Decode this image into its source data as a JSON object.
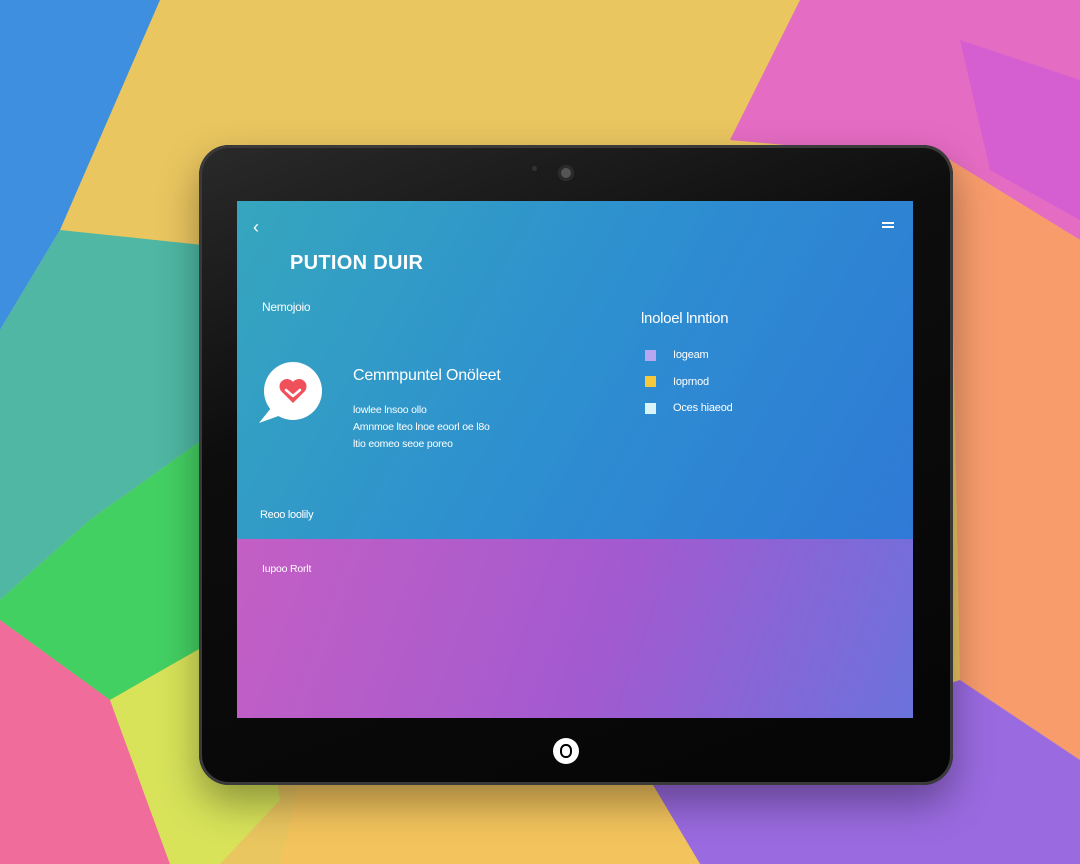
{
  "screen": {
    "title": "PUTION DUIR",
    "section_label": "Nemojoio",
    "card": {
      "title": "Cemmpuntel Onöleet",
      "description_lines": [
        "lowlee lnsoo ollo",
        "Amnmoe lteo lnoe eoorl oe l8o",
        "ltio eomeo seoe poreo"
      ]
    },
    "legend": {
      "title": "lnoloel lnntion",
      "items": [
        {
          "label": "Iogeam",
          "color": "#b9a6f0"
        },
        {
          "label": "Ioprnod",
          "color": "#f6c83c"
        },
        {
          "label": "Oces hiaeod",
          "color": "#d9f3fb"
        }
      ]
    },
    "footer_label": "Reoo loolily",
    "bottom_label": "Iupoo Rorlt"
  },
  "icons": {
    "back": "back-arrow-icon",
    "menu": "menu-icon",
    "card": "heart-chat-bubble-icon",
    "camera": "camera-icon",
    "home": "home-button-icon"
  },
  "colors": {
    "screen_top": "#2d8fd0",
    "screen_bottom": "#a25ad0",
    "heart": "#f0505a"
  }
}
